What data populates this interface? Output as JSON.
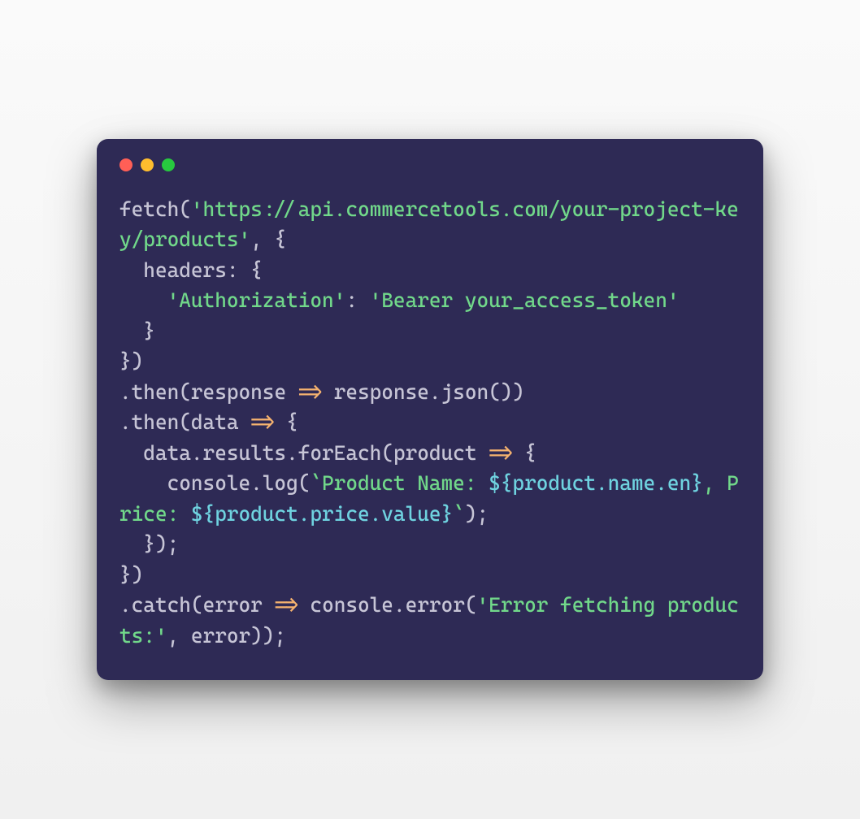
{
  "window": {
    "traffic": {
      "red": "#ff5f56",
      "yellow": "#ffbd2e",
      "green": "#27c93f"
    }
  },
  "code": {
    "tokens": [
      {
        "t": "fetch",
        "c": "fn"
      },
      {
        "t": "(",
        "c": "punct"
      },
      {
        "t": "'https://api.commercetools.com/your-project-key/products'",
        "c": "str"
      },
      {
        "t": ", {",
        "c": "punct"
      },
      {
        "t": "\n  headers: {",
        "c": "key"
      },
      {
        "t": "\n    ",
        "c": "punct"
      },
      {
        "t": "'Authorization'",
        "c": "str"
      },
      {
        "t": ": ",
        "c": "punct"
      },
      {
        "t": "'Bearer your_access_token'",
        "c": "str"
      },
      {
        "t": "\n  }\n})",
        "c": "punct"
      },
      {
        "t": "\n.",
        "c": "punct"
      },
      {
        "t": "then",
        "c": "method"
      },
      {
        "t": "(",
        "c": "punct"
      },
      {
        "t": "response",
        "c": "param"
      },
      {
        "t": " ",
        "c": "punct"
      },
      {
        "t": "=>",
        "c": "arrow"
      },
      {
        "t": " response.",
        "c": "param"
      },
      {
        "t": "json",
        "c": "method"
      },
      {
        "t": "())",
        "c": "punct"
      },
      {
        "t": "\n.",
        "c": "punct"
      },
      {
        "t": "then",
        "c": "method"
      },
      {
        "t": "(",
        "c": "punct"
      },
      {
        "t": "data",
        "c": "param"
      },
      {
        "t": " ",
        "c": "punct"
      },
      {
        "t": "=>",
        "c": "arrow"
      },
      {
        "t": " {",
        "c": "punct"
      },
      {
        "t": "\n  data.results.",
        "c": "param"
      },
      {
        "t": "forEach",
        "c": "method"
      },
      {
        "t": "(",
        "c": "punct"
      },
      {
        "t": "product",
        "c": "param"
      },
      {
        "t": " ",
        "c": "punct"
      },
      {
        "t": "=>",
        "c": "arrow"
      },
      {
        "t": " {",
        "c": "punct"
      },
      {
        "t": "\n    console.",
        "c": "param"
      },
      {
        "t": "log",
        "c": "method"
      },
      {
        "t": "(",
        "c": "punct"
      },
      {
        "t": "`Product Name: ",
        "c": "tmpl"
      },
      {
        "t": "${product.name.en}",
        "c": "interp"
      },
      {
        "t": ", Price: ",
        "c": "tmpl"
      },
      {
        "t": "${product.price.value}",
        "c": "interp"
      },
      {
        "t": "`",
        "c": "tmpl"
      },
      {
        "t": ");",
        "c": "punct"
      },
      {
        "t": "\n  });",
        "c": "punct"
      },
      {
        "t": "\n})",
        "c": "punct"
      },
      {
        "t": "\n.",
        "c": "punct"
      },
      {
        "t": "catch",
        "c": "method"
      },
      {
        "t": "(",
        "c": "punct"
      },
      {
        "t": "error",
        "c": "param"
      },
      {
        "t": " ",
        "c": "punct"
      },
      {
        "t": "=>",
        "c": "arrow"
      },
      {
        "t": " console.",
        "c": "param"
      },
      {
        "t": "error",
        "c": "method"
      },
      {
        "t": "(",
        "c": "punct"
      },
      {
        "t": "'Error fetching products:'",
        "c": "str"
      },
      {
        "t": ", error));",
        "c": "punct"
      }
    ]
  }
}
